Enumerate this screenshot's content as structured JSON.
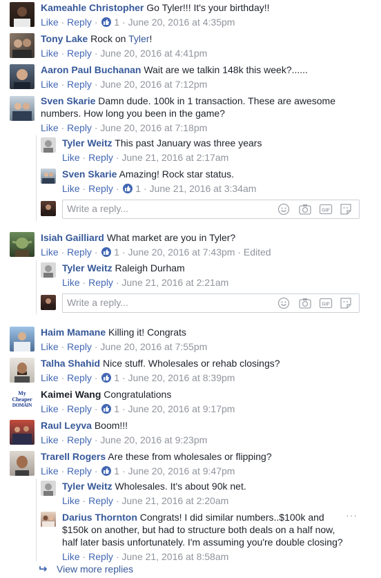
{
  "actions": {
    "like": "Like",
    "reply": "Reply",
    "sep": " · "
  },
  "comments": [
    {
      "name": "Kameahle Christopher",
      "text": "Go Tyler!!! It's your birthday!!",
      "likes": "1",
      "date": "June 20, 2016 at 4:35pm"
    },
    {
      "name": "Tony Lake",
      "text": "Rock on ",
      "mention": "Tyler",
      "text_after": "!",
      "date": "June 20, 2016 at 4:41pm"
    },
    {
      "name": "Aaron Paul Buchanan",
      "text": "Wait are we talkin 148k this week?......",
      "date": "June 20, 2016 at 7:12pm"
    },
    {
      "name": "Sven Skarie",
      "text": "Damn dude. 100k in 1 transaction. These are awesome numbers. How long you been in the game?",
      "date": "June 20, 2016 at 7:18pm"
    },
    {
      "name": "Isiah Gailliard",
      "text": "What market are you in Tyler?",
      "likes": "1",
      "date": "June 20, 2016 at 7:43pm",
      "edited": "Edited"
    },
    {
      "name": "Haim Mamane",
      "text": "Killing it! Congrats",
      "date": "June 20, 2016 at 7:55pm"
    },
    {
      "name": "Talha Shahid",
      "text": "Nice stuff. Wholesales or rehab closings?",
      "likes": "1",
      "date": "June 20, 2016 at 8:39pm"
    },
    {
      "name": "Kaimei Wang",
      "text": "Congratulations",
      "likes": "1",
      "date": "June 20, 2016 at 9:17pm",
      "avatar_text": [
        "My",
        "Cheaper",
        "DOMAIN"
      ]
    },
    {
      "name": "Raul Leyva",
      "text": "Boom!!!",
      "date": "June 20, 2016 at 9:23pm"
    },
    {
      "name": "Trarell Rogers",
      "text": "Are these from wholesales or flipping?",
      "likes": "1",
      "date": "June 20, 2016 at 9:47pm"
    }
  ],
  "replies": [
    {
      "name": "Tyler Weitz",
      "text": "This past January was three years",
      "date": "June 21, 2016 at 2:17am"
    },
    {
      "name": "Sven Skarie",
      "text": "Amazing! Rock star status.",
      "likes": "1",
      "date": "June 21, 2016 at 3:34am"
    },
    {
      "name": "Tyler Weitz",
      "text": "Raleigh Durham",
      "date": "June 21, 2016 at 2:21am"
    },
    {
      "name": "Tyler Weitz",
      "text": "Wholesales. It's about 90k net.",
      "date": "June 21, 2016 at 2:20am"
    },
    {
      "name": "Darius Thornton",
      "text": "Congrats! I did similar numbers..$100k and $150k on another, but had to structure both deals on a half now, half later basis unfortunately. I'm assuming you're double closing?",
      "date": "June 21, 2016 at 8:58am"
    }
  ],
  "reply_box": {
    "placeholder": "Write a reply..."
  },
  "more_menu": "···",
  "view_more": "View more replies",
  "colors": {
    "name": "#365899",
    "link": "#4267b2",
    "meta": "#90949c",
    "text": "#1d2129"
  }
}
